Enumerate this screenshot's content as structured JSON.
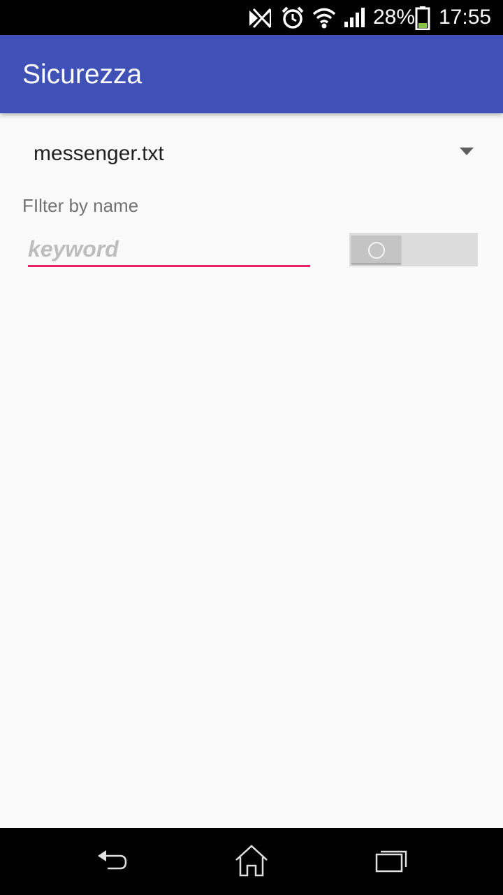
{
  "status_bar": {
    "battery_text": "28%",
    "time": "17:55",
    "icons": [
      "nfc-icon",
      "alarm-clock-icon",
      "wifi-icon",
      "signal-icon",
      "battery-icon"
    ]
  },
  "app_bar": {
    "title": "Sicurezza",
    "color": "#3f51b5"
  },
  "main": {
    "spinner": {
      "selected": "messenger.txt"
    },
    "filter": {
      "label": "FIlter by name",
      "placeholder": "keyword",
      "value": "",
      "accent_color": "#e91e63"
    },
    "toggle": {
      "checked": false
    }
  },
  "nav_bar": {
    "buttons": [
      "back-icon",
      "home-icon",
      "recents-icon"
    ]
  }
}
